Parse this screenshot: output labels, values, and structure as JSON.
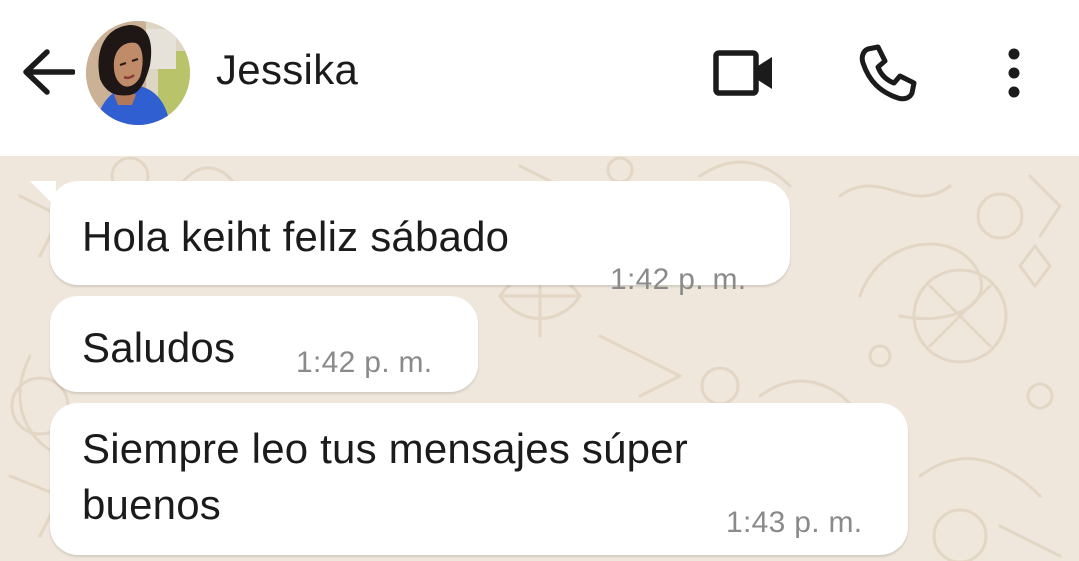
{
  "header": {
    "contact_name": "Jessika",
    "icons": {
      "back": "arrow-left-icon",
      "video": "video-camera-icon",
      "call": "phone-icon",
      "menu": "more-vertical-icon"
    }
  },
  "messages": [
    {
      "text": "Hola keiht feliz sábado",
      "time": "1:42 p. m."
    },
    {
      "text": "Saludos",
      "time": "1:42 p. m."
    },
    {
      "text": "Siempre leo tus mensajes súper buenos",
      "time": "1:43 p. m."
    }
  ],
  "colors": {
    "chat_background": "#efe7dc",
    "bubble": "#ffffff",
    "timestamp": "#8a8a8a",
    "text": "#1b1b1b"
  }
}
